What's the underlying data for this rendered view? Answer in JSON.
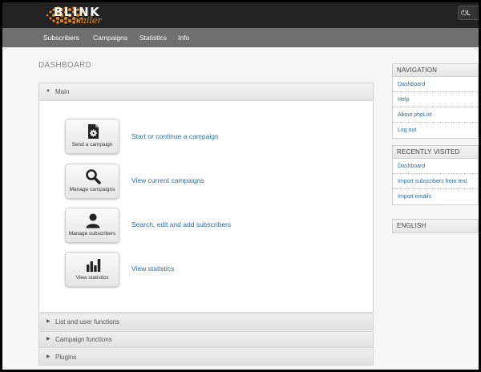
{
  "app": {
    "logo_text": "BLINK",
    "logo_sub": "mailer",
    "logout_icon": "power-icon",
    "logout_label": "L"
  },
  "nav": {
    "items": [
      "Subscribers",
      "Campaigns",
      "Statistics",
      "Info"
    ]
  },
  "page": {
    "title": "DASHBOARD"
  },
  "main_panel": {
    "title": "Main",
    "actions": [
      {
        "label": "Send a campaign",
        "link": "Start or continue a campaign",
        "icon": "document-gear-icon"
      },
      {
        "label": "Manage campaigns",
        "link": "View current campaigns",
        "icon": "magnifier-icon"
      },
      {
        "label": "Manage subscribers",
        "link": "Search, edit and add subscribers",
        "icon": "person-icon"
      },
      {
        "label": "View statistics",
        "link": "View statistics",
        "icon": "bar-chart-icon"
      }
    ]
  },
  "collapsed_panels": [
    "List and user functions",
    "Campaign functions",
    "Plugins"
  ],
  "sidebar": {
    "navigation": {
      "title": "NAVIGATION",
      "items": [
        "Dashboard",
        "Help",
        "About phpList",
        "Log out"
      ]
    },
    "recent": {
      "title": "RECENTLY VISITED",
      "items": [
        "Dashboard",
        "Import subscribers from text",
        "Import emails"
      ]
    },
    "language": {
      "title": "ENGLISH"
    }
  },
  "colors": {
    "accent": "#e8861d",
    "link": "#2b6da3",
    "navbar": "#6f6f6f",
    "topbar": "#222222"
  }
}
